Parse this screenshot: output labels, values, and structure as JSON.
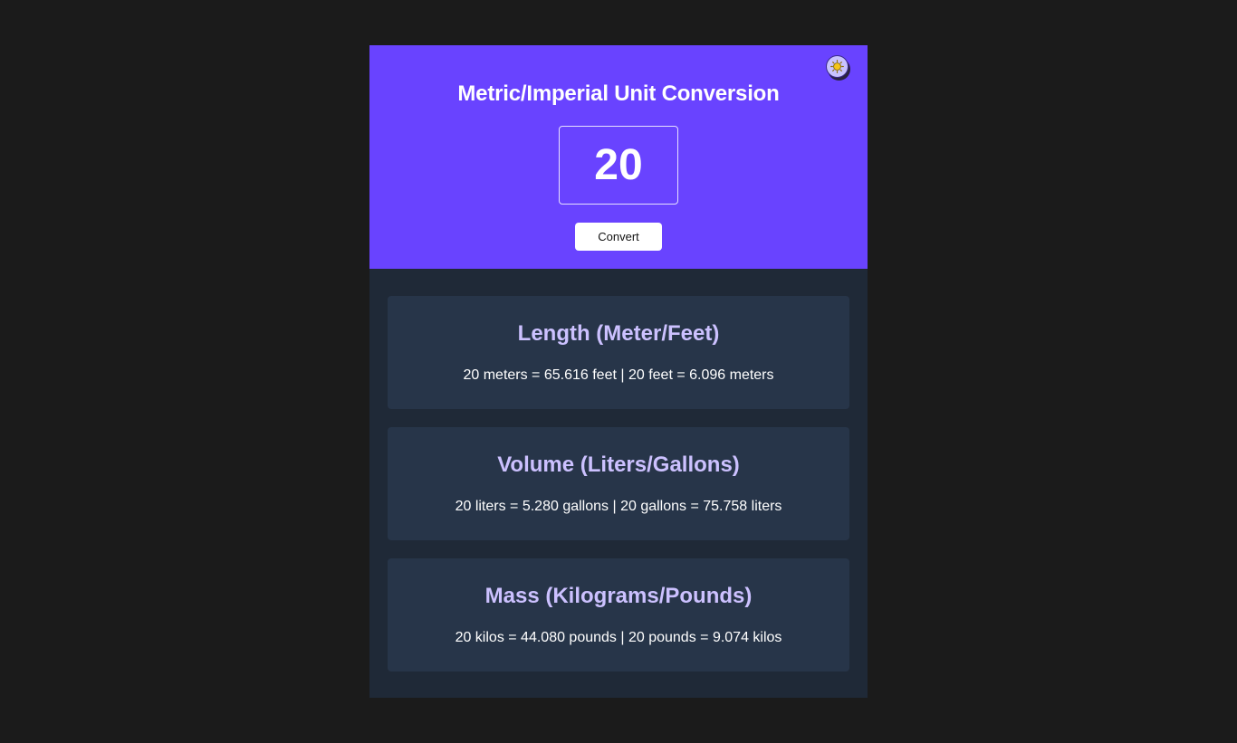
{
  "header": {
    "title": "Metric/Imperial Unit Conversion",
    "input_value": "20",
    "convert_label": "Convert",
    "theme_icon": "sun-icon"
  },
  "results": [
    {
      "title": "Length (Meter/Feet)",
      "text": "20 meters = 65.616 feet | 20 feet = 6.096 meters"
    },
    {
      "title": "Volume (Liters/Gallons)",
      "text": "20 liters = 5.280 gallons | 20 gallons = 75.758 liters"
    },
    {
      "title": "Mass (Kilograms/Pounds)",
      "text": "20 kilos = 44.080 pounds | 20 pounds = 9.074 kilos"
    }
  ],
  "colors": {
    "page_bg": "#1b1b1b",
    "header_bg": "#6943ff",
    "body_bg": "#1f2937",
    "card_bg": "#273549",
    "card_title": "#ccc1ff",
    "text": "#ffffff"
  }
}
